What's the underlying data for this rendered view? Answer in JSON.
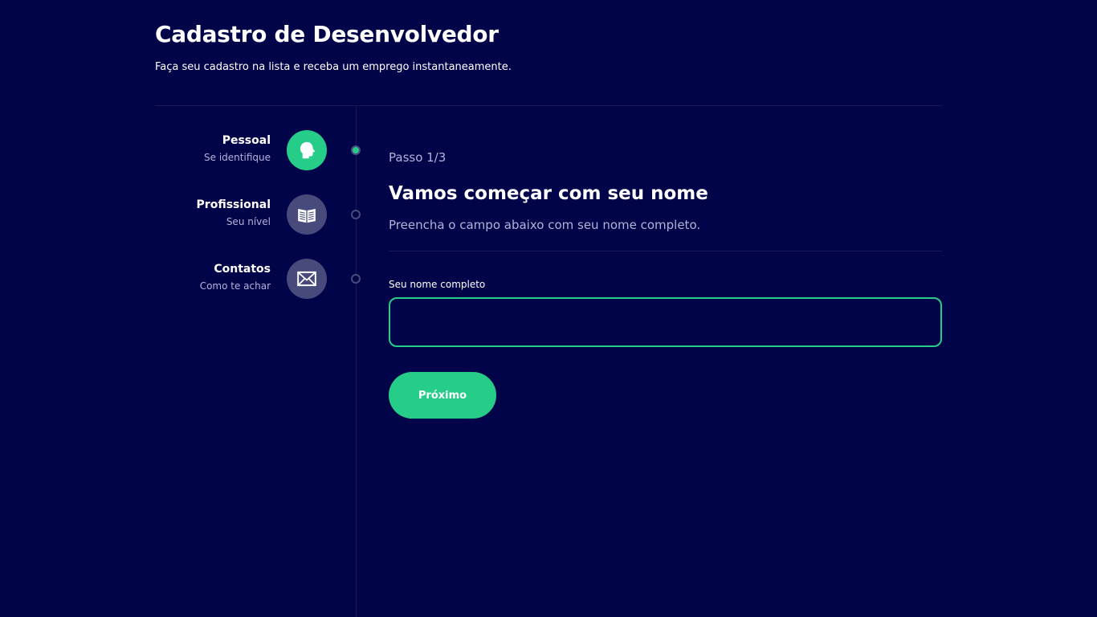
{
  "header": {
    "title": "Cadastro de Desenvolvedor",
    "subtitle": "Faça seu cadastro na lista e receba um emprego instantaneamente."
  },
  "steps": [
    {
      "title": "Pessoal",
      "description": "Se identifique",
      "icon": "person-head-icon",
      "active": true
    },
    {
      "title": "Profissional",
      "description": "Seu nível",
      "icon": "book-icon",
      "active": false
    },
    {
      "title": "Contatos",
      "description": "Como te achar",
      "icon": "mail-icon",
      "active": false
    }
  ],
  "main": {
    "step_count": "Passo 1/3",
    "title": "Vamos começar com seu nome",
    "description": "Preencha o campo abaixo com seu nome completo.",
    "field": {
      "label": "Seu nome completo",
      "value": "",
      "placeholder": ""
    },
    "next_button_label": "Próximo"
  },
  "colors": {
    "background": "#02044A",
    "accent": "#25CD89",
    "inactive": "#494A7C",
    "muted_text": "#B2B3D9"
  }
}
